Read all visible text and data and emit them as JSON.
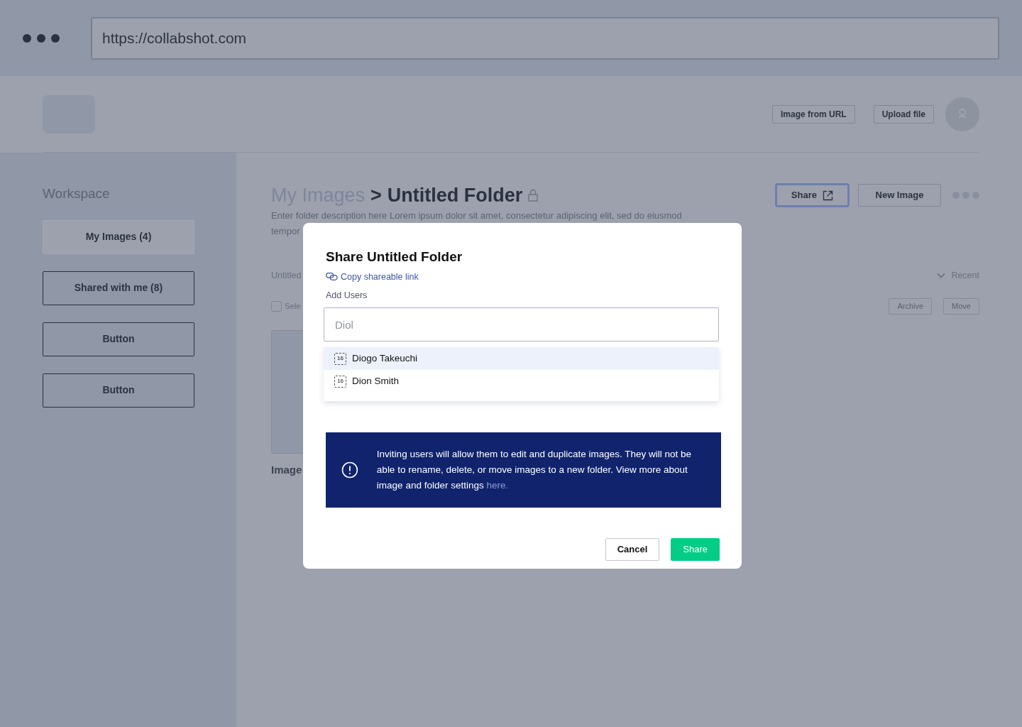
{
  "browser": {
    "url": "https://collabshot.com"
  },
  "header": {
    "buttons": [
      "Image from URL",
      "Upload file"
    ]
  },
  "sidebar": {
    "title": "Workspace",
    "items": [
      {
        "label": "My Images (4)",
        "selected": true
      },
      {
        "label": "Shared with me (8)",
        "selected": false
      },
      {
        "label": "Button",
        "selected": false
      },
      {
        "label": "Button",
        "selected": false
      }
    ]
  },
  "main": {
    "breadcrumb": {
      "parent": "My Images",
      "separator": ">",
      "current": "Untitled Folder"
    },
    "actions": [
      {
        "label": "Share",
        "kind": "share"
      },
      {
        "label": "New Image",
        "kind": "plain"
      }
    ],
    "description": [
      "Enter folder description here Lorem ipsum dolor sit amet, consectetur adipiscing elit, sed do eiusmod",
      "tempor"
    ],
    "section_title": "Untitled",
    "select_checked": false,
    "select_label": "Sele",
    "sort": "Recent",
    "bulk_buttons": [
      "Archive",
      "Move"
    ],
    "card_caption": "Image"
  },
  "modal": {
    "title": "Share Untitled Folder",
    "copy_link": "Copy shareable link",
    "field_label": "Add Users",
    "input": "Diol",
    "suggestions": [
      {
        "name": "Diogo Takeuchi",
        "icon": "16",
        "selected": true
      },
      {
        "name": "Dion Smith",
        "icon": "16",
        "selected": false
      }
    ],
    "notice": "Inviting users will allow them to edit and duplicate images. They will not be able to rename, delete, or move images to a new folder. View more about image and folder settings",
    "notice_link": "here.",
    "buttons": [
      {
        "label": "Cancel",
        "kind": "secondary"
      },
      {
        "label": "Share",
        "kind": "primary"
      }
    ]
  }
}
